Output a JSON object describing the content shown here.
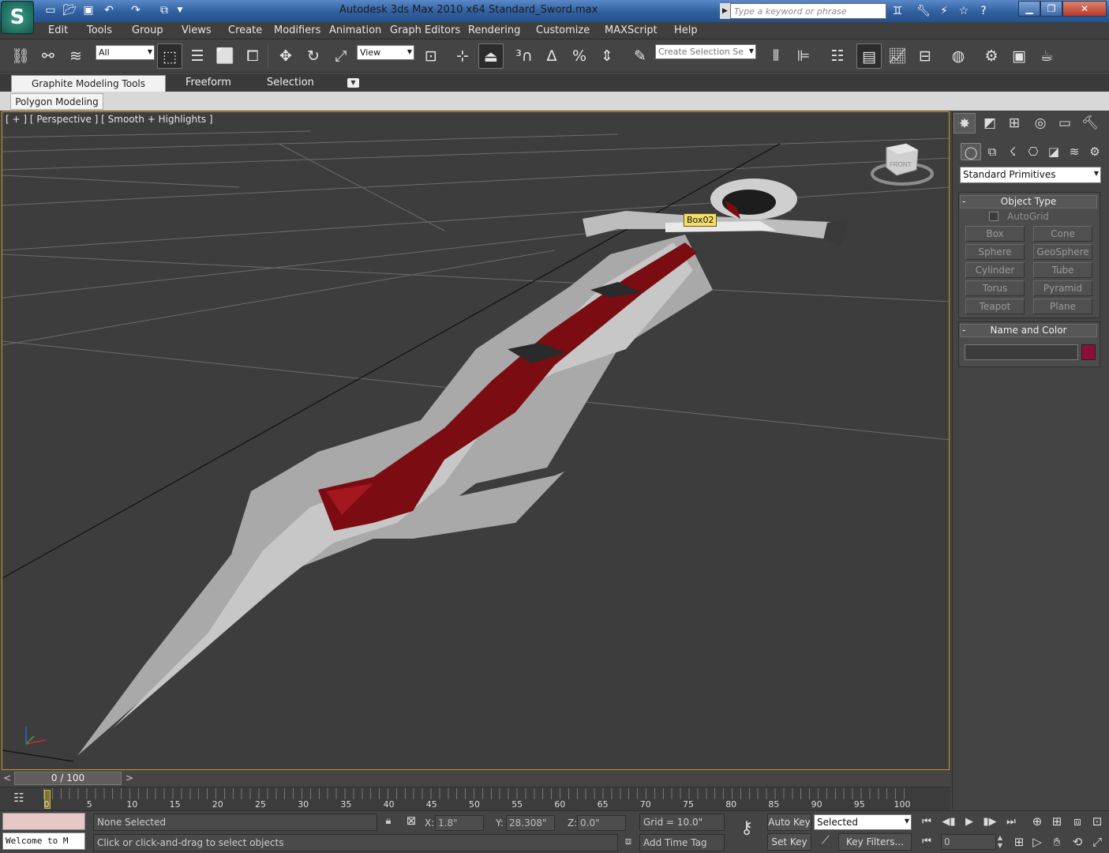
{
  "window": {
    "app_title": "Autodesk 3ds Max  2010 x64",
    "file_title": "Standard_Sword.max",
    "search_placeholder": "Type a keyword or phrase",
    "logo": "S"
  },
  "menu": [
    "Edit",
    "Tools",
    "Group",
    "Views",
    "Create",
    "Modifiers",
    "Animation",
    "Graph Editors",
    "Rendering",
    "Customize",
    "MAXScript",
    "Help"
  ],
  "toolbar": {
    "selection_filter": "All",
    "ref_coord": "View",
    "named_selection": "Create Selection Se"
  },
  "ribbon": {
    "tabs": [
      "Graphite Modeling Tools",
      "Freeform",
      "Selection"
    ],
    "active_panel": "Polygon Modeling"
  },
  "viewport": {
    "label": "[ + ] [ Perspective ] [ Smooth + Highlights ]",
    "object_tooltip": "Box02",
    "viewcube_label": "FRONT"
  },
  "command_panel": {
    "category": "Standard Primitives",
    "object_type_title": "Object Type",
    "autogrid_label": "AutoGrid",
    "primitives": [
      "Box",
      "Cone",
      "Sphere",
      "GeoSphere",
      "Cylinder",
      "Tube",
      "Torus",
      "Pyramid",
      "Teapot",
      "Plane"
    ],
    "name_color_title": "Name and Color",
    "object_color": "#8c0f3a"
  },
  "timeline": {
    "slider_label": "0 / 100",
    "ticks": [
      "0",
      "5",
      "10",
      "15",
      "20",
      "25",
      "30",
      "35",
      "40",
      "45",
      "50",
      "55",
      "60",
      "65",
      "70",
      "75",
      "80",
      "85",
      "90",
      "95",
      "100"
    ]
  },
  "status": {
    "maxscript_text": "Welcome to M",
    "selection_info": "None Selected",
    "prompt": "Click or click-and-drag to select objects",
    "x_label": "X:",
    "x_value": "1.8\"",
    "y_label": "Y:",
    "y_value": "28.308\"",
    "z_label": "Z:",
    "z_value": "0.0\"",
    "grid": "Grid = 10.0\"",
    "add_time_tag": "Add Time Tag",
    "auto_key": "Auto Key",
    "set_key": "Set Key",
    "key_mode": "Selected",
    "key_filters": "Key Filters...",
    "current_frame": "0"
  }
}
